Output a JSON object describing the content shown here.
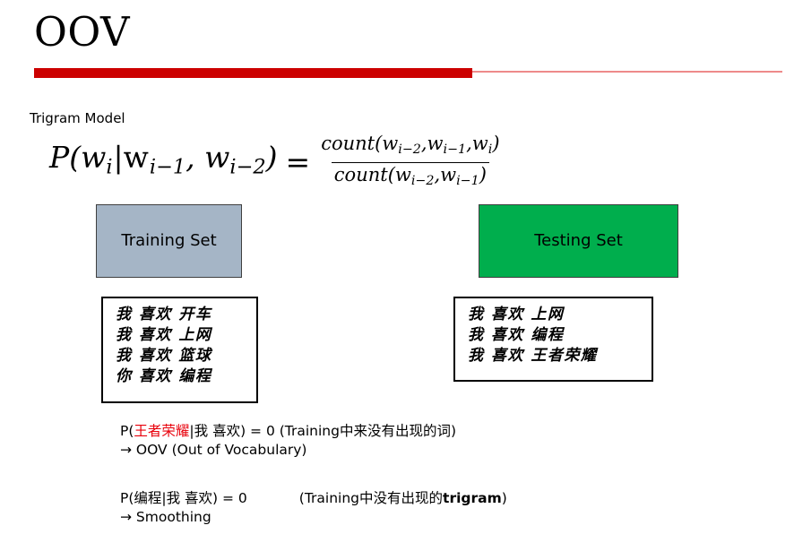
{
  "slide": {
    "title": "OOV",
    "subtitle": "Trigram Model",
    "accent_color": "#CC0000",
    "accent_light_color": "#EE8A8A"
  },
  "formula": {
    "lhs": "P(w",
    "lhs_sub1": "i",
    "lhs_mid": "|w",
    "lhs_sub2": "i−1",
    "lhs_mid2": ", w",
    "lhs_sub3": "i−2",
    "lhs_close": ")",
    "equals": "=",
    "numerator_fn": "count(w",
    "numerator_sub1": "i−2",
    "numerator_c1": ",w",
    "numerator_sub2": "i−1",
    "numerator_c2": ",w",
    "numerator_sub3": "i",
    "numerator_close": ")",
    "denominator_fn": "count(w",
    "denominator_sub1": "i−2",
    "denominator_c1": ",w",
    "denominator_sub2": "i−1",
    "denominator_close": ")",
    "plain_text": "P(w_i|w_{i-1}, w_{i-2}) = count(w_{i-2},w_{i-1},w_i) / count(w_{i-2},w_{i-1})"
  },
  "training": {
    "header_label": "Training Set",
    "header_color": "#A5B5C6",
    "sentences": [
      "我 喜欢 开车",
      "我 喜欢 上网",
      "我 喜欢 篮球",
      "你 喜欢 编程"
    ]
  },
  "testing": {
    "header_label": "Testing Set",
    "header_color": "#00AE4D",
    "sentences": [
      "我 喜欢 上网",
      "我 喜欢 编程",
      "我 喜欢 王者荣耀"
    ]
  },
  "notes": {
    "oov_color": "#E8000B",
    "line1_prefix": "P(",
    "line1_oov_word": "王者荣耀",
    "line1_middle": "|我 喜欢) = 0 (Training",
    "line1_suffix": "中来没有出现的词)",
    "line2": "→ OOV (Out of Vocabulary)",
    "line3_prefix": "P(编程|我 喜欢) = 0",
    "line3_paren_open": "(Training",
    "line3_cn": "中没有出现的",
    "line3_bold": "trigram",
    "line3_paren_close": ")",
    "line4": "→ Smoothing"
  }
}
